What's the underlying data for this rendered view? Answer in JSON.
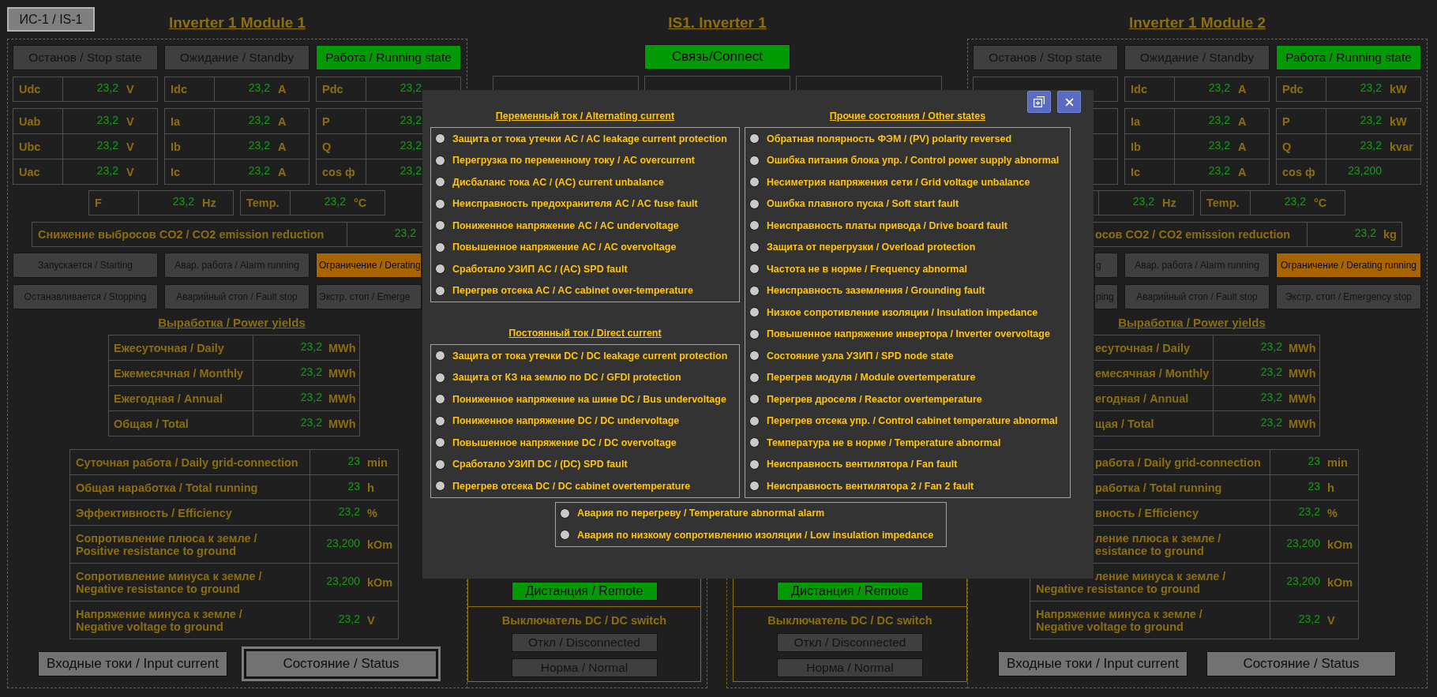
{
  "nav_button": {
    "label": "ИС-1 / IS-1"
  },
  "modules": [
    {
      "title": "Inverter 1 Module 1",
      "states": [
        {
          "label": "Останов / Stop state",
          "on": false
        },
        {
          "label": "Ожидание / Standby",
          "on": false
        },
        {
          "label": "Работа / Running state",
          "on": true
        }
      ],
      "dc_readings": [
        {
          "label": "Udc",
          "value": "23,2",
          "unit": "V"
        },
        {
          "label": "Idc",
          "value": "23,2",
          "unit": "A"
        },
        {
          "label": "Pdc",
          "value": "23,2"
        }
      ],
      "ac_readings": [
        [
          {
            "label": "Uab",
            "value": "23,2",
            "unit": "V"
          },
          {
            "label": "Ia",
            "value": "23,2",
            "unit": "A"
          },
          {
            "label": "P",
            "value": "23,2"
          }
        ],
        [
          {
            "label": "Ubc",
            "value": "23,2",
            "unit": "V"
          },
          {
            "label": "Ib",
            "value": "23,2",
            "unit": "A"
          },
          {
            "label": "Q",
            "value": "23,2"
          }
        ],
        [
          {
            "label": "Uac",
            "value": "23,2",
            "unit": "V"
          },
          {
            "label": "Ic",
            "value": "23,2",
            "unit": "A"
          },
          {
            "label": "cos ф",
            "value": "23,2"
          }
        ]
      ],
      "grid_readings": [
        {
          "label": "F",
          "value": "23,2",
          "unit": "Hz"
        },
        {
          "label": "Temp.",
          "value": "23,2",
          "unit": "°C"
        }
      ],
      "co2": {
        "label": "Снижение выбросов CO2 / CO2 emission reduction",
        "value": "23,2"
      },
      "alarms": [
        [
          {
            "label": "Запускается / Starting",
            "on": false
          },
          {
            "label": "Авар. работа / Alarm running",
            "on": false
          },
          {
            "label": "Ограничение / Derating",
            "on": true,
            "clipped_right": true
          }
        ],
        [
          {
            "label": "Останавливается / Stopping",
            "on": false
          },
          {
            "label": "Аварийный стоп / Fault stop",
            "on": false
          },
          {
            "label": "Экстр. стоп / Emerge",
            "on": false,
            "clipped_right": true
          }
        ]
      ],
      "yields_title": "Выработка / Power yields",
      "yields": [
        {
          "label": "Ежесуточная / Daily",
          "value": "23,2",
          "unit": "MWh"
        },
        {
          "label": "Ежемесячная / Monthly",
          "value": "23,2",
          "unit": "MWh"
        },
        {
          "label": "Ежегодная / Annual",
          "value": "23,2",
          "unit": "MWh"
        },
        {
          "label": "Общая / Total",
          "value": "23,2",
          "unit": "MWh"
        }
      ],
      "operation": [
        {
          "label": "Суточная работа / Daily grid-connection",
          "value": "23",
          "unit": "min"
        },
        {
          "label": "Общая наработка / Total running",
          "value": "23",
          "unit": "h"
        },
        {
          "label": "Эффективность / Efficiency",
          "value": "23,2",
          "unit": "%"
        },
        {
          "label": "Сопротивление плюса к земле /\nPositive resistance to ground",
          "value": "23,200",
          "unit": "kOm"
        },
        {
          "label": "Сопротивление минуса к земле /\nNegative resistance to ground",
          "value": "23,200",
          "unit": "kOm"
        },
        {
          "label": "Напряжение минуса к земле /\nNegative voltage to ground",
          "value": "23,2",
          "unit": "V"
        }
      ],
      "buttons": [
        {
          "label": "Входные токи / Input current",
          "selected": false
        },
        {
          "label": "Состояние / Status",
          "selected": true
        }
      ]
    },
    {
      "title": "Inverter 1 Module 2",
      "states": [
        {
          "label": "Останов / Stop state",
          "on": false
        },
        {
          "label": "Ожидание / Standby",
          "on": false
        },
        {
          "label": "Работа / Running state",
          "on": true
        }
      ],
      "dc_readings": [
        {
          "label": "Idc",
          "value": "23,2",
          "unit": "A"
        },
        {
          "label": "Pdc",
          "value": "23,2",
          "unit": "kW"
        }
      ],
      "ac_readings": [
        [
          {
            "label": "Ia",
            "value": "23,2",
            "unit": "A"
          },
          {
            "label": "P",
            "value": "23,2",
            "unit": "kW"
          }
        ],
        [
          {
            "label": "Ib",
            "value": "23,2",
            "unit": "A"
          },
          {
            "label": "Q",
            "value": "23,2",
            "unit": "kvar"
          }
        ],
        [
          {
            "label": "Ic",
            "value": "23,2",
            "unit": "A"
          },
          {
            "label": "cos ф",
            "value": "23,200"
          }
        ]
      ],
      "grid_readings": [
        {
          "value": "23,2",
          "unit": "Hz"
        },
        {
          "label": "Temp.",
          "value": "23,2",
          "unit": "°C"
        }
      ],
      "co2": {
        "label": "осов CO2 / CO2 emission reduction",
        "value": "23,2",
        "unit": "kg",
        "clipped_left": true
      },
      "alarms": [
        [
          {
            "label": "g",
            "on": false,
            "clipped_left": true
          },
          {
            "label": "Авар. работа / Alarm running",
            "on": false
          },
          {
            "label": "Ограничение / Derating running",
            "on": true
          }
        ],
        [
          {
            "label": "ping",
            "on": false,
            "clipped_left": true
          },
          {
            "label": "Аварийный стоп / Fault stop",
            "on": false
          },
          {
            "label": "Экстр. стоп / Emergency stop",
            "on": false
          }
        ]
      ],
      "yields_title": "Выработка / Power yields",
      "yields": [
        {
          "label": "есуточная / Daily",
          "value": "23,2",
          "unit": "MWh",
          "clipped_left": true
        },
        {
          "label": "емесячная / Monthly",
          "value": "23,2",
          "unit": "MWh",
          "clipped_left": true
        },
        {
          "label": "егодная / Annual",
          "value": "23,2",
          "unit": "MWh",
          "clipped_left": true
        },
        {
          "label": "щая / Total",
          "value": "23,2",
          "unit": "MWh",
          "clipped_left": true
        }
      ],
      "operation": [
        {
          "label": "работа / Daily grid-connection",
          "value": "23",
          "unit": "min",
          "clipped_left": true
        },
        {
          "label": "работка / Total running",
          "value": "23",
          "unit": "h",
          "clipped_left": true
        },
        {
          "label": "вность / Efficiency",
          "value": "23,2",
          "unit": "%",
          "clipped_left": true
        },
        {
          "label": "ление плюса к земле /\nesistance to ground",
          "value": "23,200",
          "unit": "kOm",
          "clipped_left": true
        },
        {
          "label": "ление минуса к земле /\nNegative resistance to ground",
          "value": "23,200",
          "unit": "kOm",
          "clipped_first_line": true
        },
        {
          "label": "Напряжение минуса к земле /\nNegative voltage to ground",
          "value": "23,2",
          "unit": "V"
        }
      ],
      "buttons": [
        {
          "label": "Входные токи / Input current",
          "selected": false
        },
        {
          "label": "Состояние / Status",
          "selected": false
        }
      ]
    }
  ],
  "center": {
    "title": "IS1. Inverter 1",
    "connect": {
      "label": "Связь/Connect",
      "on": true
    },
    "sections": [
      {
        "remote": {
          "label": "Дистанция / Remote",
          "on": true
        },
        "switch_title": "Выключатель DC / DC switch",
        "switch_states": [
          {
            "label": "Откл / Disconnected",
            "on": false
          },
          {
            "label": "Норма / Normal",
            "on": false
          }
        ]
      },
      {
        "remote": {
          "label": "Дистанция / Remote",
          "on": true
        },
        "switch_title": "Выключатель DC / DC switch",
        "switch_states": [
          {
            "label": "Откл / Disconnected",
            "on": false
          },
          {
            "label": "Норма / Normal",
            "on": false
          }
        ]
      }
    ]
  },
  "dialog": {
    "groups": [
      {
        "title": "Переменный ток / Alternating current",
        "alarms": [
          {
            "label": "Защита от тока утечки AC / AC leakage current protection",
            "on": false
          },
          {
            "label": "Перегрузка по переменному току / AC overcurrent",
            "on": false
          },
          {
            "label": "Дисбаланс тока AC / (AC) current unbalance",
            "on": false
          },
          {
            "label": "Неисправность предохранителя AC / AC fuse fault",
            "on": false
          },
          {
            "label": "Пониженное напряжение AC / AC undervoltage",
            "on": false
          },
          {
            "label": "Повышенное напряжение AC / AC overvoltage",
            "on": false
          },
          {
            "label": "Сработало УЗИП AC / (AC) SPD fault",
            "on": false
          },
          {
            "label": "Перегрев отсека AC / AC cabinet over-temperature",
            "on": false
          }
        ]
      },
      {
        "title": "Постоянный ток / Direct current",
        "alarms": [
          {
            "label": "Защита от тока утечки DC / DC leakage current protection",
            "on": false
          },
          {
            "label": "Защита от КЗ на землю по DC / GFDI protection",
            "on": false
          },
          {
            "label": "Пониженное напряжение на шине DC / Bus undervoltage",
            "on": false
          },
          {
            "label": "Пониженное напряжение DC / DC undervoltage",
            "on": false
          },
          {
            "label": "Повышенное напряжение DC / DC overvoltage",
            "on": false
          },
          {
            "label": "Сработало УЗИП DC / (DC) SPD fault",
            "on": false
          },
          {
            "label": "Перегрев отсека DC / DC cabinet overtemperature",
            "on": false
          }
        ]
      },
      {
        "title": "Прочие состояния / Other states",
        "alarms": [
          {
            "label": "Обратная полярность ФЭМ / (PV) polarity reversed",
            "on": false
          },
          {
            "label": "Ошибка питания блока упр. / Control power supply abnormal",
            "on": false
          },
          {
            "label": "Несиметрия напряжения сети / Grid voltage unbalance",
            "on": false
          },
          {
            "label": "Ошибка плавного пуска / Soft start fault",
            "on": false
          },
          {
            "label": "Неисправность платы привода / Drive board fault",
            "on": false
          },
          {
            "label": "Защита от перегрузки / Overload protection",
            "on": false
          },
          {
            "label": "Частота не в норме / Frequency abnormal",
            "on": false
          },
          {
            "label": "Неисправность заземления / Grounding fault",
            "on": false
          },
          {
            "label": "Низкое сопротивление изоляции / Insulation impedance",
            "on": false
          },
          {
            "label": "Повышенное напряжение инвертора / Inverter overvoltage",
            "on": false
          },
          {
            "label": "Состояние узла УЗИП / SPD node state",
            "on": false
          },
          {
            "label": "Перегрев модуля / Module overtemperature",
            "on": false
          },
          {
            "label": "Перегрев дроселя / Reactor overtemperature",
            "on": false
          },
          {
            "label": "Перегрев отсека упр. / Control cabinet temperature abnormal",
            "on": false
          },
          {
            "label": "Температура не в норме / Temperature abnormal",
            "on": false
          },
          {
            "label": "Неисправность вентилятора / Fan fault",
            "on": false
          },
          {
            "label": "Неисправность вентилятора 2 / Fan 2 fault",
            "on": false
          }
        ]
      },
      {
        "alarms": [
          {
            "label": "Авария по перегреву / Temperature abnormal alarm",
            "on": false
          },
          {
            "label": "Авария по низкому сопротивлению изоляции / Low insulation impedance",
            "on": false
          }
        ]
      }
    ]
  }
}
